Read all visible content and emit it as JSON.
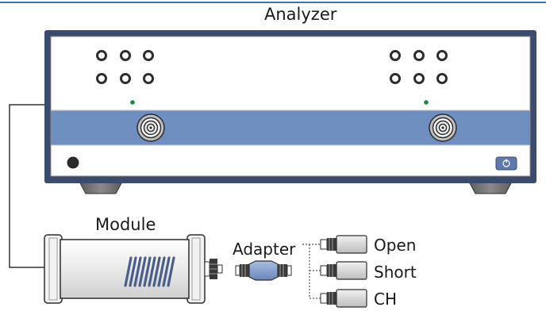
{
  "analyzer": {
    "title": "Analyzer"
  },
  "module": {
    "title": "Module"
  },
  "adapter": {
    "title": "Adapter"
  },
  "standards": [
    {
      "label": "Open"
    },
    {
      "label": "Short"
    },
    {
      "label": "CH"
    }
  ],
  "colors": {
    "frame": "#3c4a6b",
    "port_band": "#6f8fc1",
    "led": "#1f8a3c",
    "top_rule": "#3d77ad",
    "connector_blue": "#7d97c6",
    "standard_body": "#d3d3d3"
  }
}
